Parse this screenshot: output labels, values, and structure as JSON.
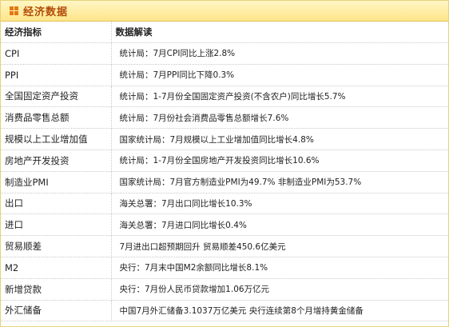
{
  "panel": {
    "title": "经济数据",
    "columns": {
      "indicator": "经济指标",
      "interpretation": "数据解读"
    },
    "rows": [
      {
        "indicator": "CPI",
        "interpretation": "统计局：7月CPI同比上涨2.8%"
      },
      {
        "indicator": "PPI",
        "interpretation": "统计局：7月PPI同比下降0.3%"
      },
      {
        "indicator": "全国固定资产投资",
        "interpretation": "统计局：1-7月份全国固定资产投资(不含农户)同比增长5.7%"
      },
      {
        "indicator": "消费品零售总额",
        "interpretation": "统计局：7月份社会消费品零售总额增长7.6%"
      },
      {
        "indicator": "规模以上工业增加值",
        "interpretation": "国家统计局：7月规模以上工业增加值同比增长4.8%"
      },
      {
        "indicator": "房地产开发投资",
        "interpretation": "统计局：1-7月份全国房地产开发投资同比增长10.6%"
      },
      {
        "indicator": "制造业PMI",
        "interpretation": "国家统计局：7月官方制造业PMI为49.7% 非制造业PMI为53.7%"
      },
      {
        "indicator": "出口",
        "interpretation": "海关总署：7月出口同比增长10.3%"
      },
      {
        "indicator": "进口",
        "interpretation": "海关总署：7月进口同比增长0.4%"
      },
      {
        "indicator": "贸易顺差",
        "interpretation": "7月进出口超预期回升 贸易顺差450.6亿美元"
      },
      {
        "indicator": "M2",
        "interpretation": "央行：7月末中国M2余额同比增长8.1%"
      },
      {
        "indicator": "新增贷款",
        "interpretation": "央行：7月份人民币贷款增加1.06万亿元"
      },
      {
        "indicator": "外汇储备",
        "interpretation": "中国7月外汇储备3.1037万亿美元 央行连续第8个月增持黄金储备"
      }
    ]
  }
}
